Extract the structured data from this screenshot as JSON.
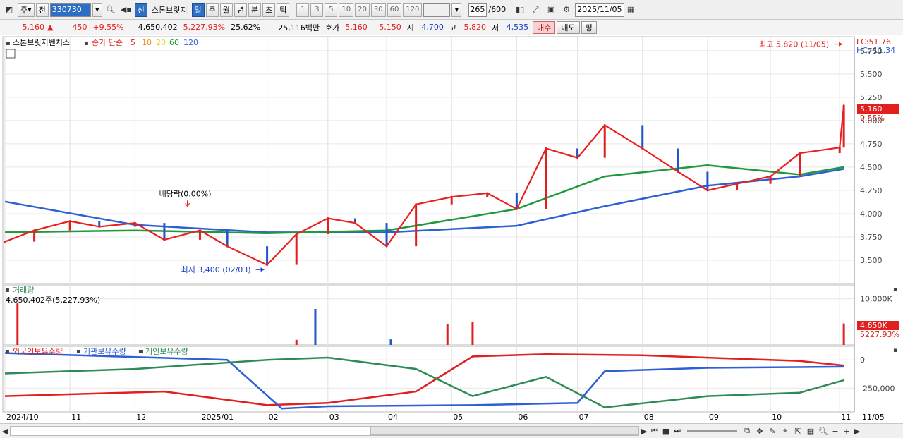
{
  "toolbar": {
    "period_select": "주",
    "prev_label": "전",
    "code": "330730",
    "new_label": "신",
    "name": "스톤브릿지",
    "period_tabs": [
      "일",
      "주",
      "월",
      "년",
      "분",
      "초",
      "틱"
    ],
    "active_tab": "일",
    "intervals": [
      "1",
      "3",
      "5",
      "10",
      "20",
      "30",
      "60",
      "120"
    ],
    "count": "265",
    "count_total": "/600",
    "date": "2025/11/05",
    "icons": [
      "search-icon",
      "sound-icon",
      "candle-icon",
      "compare-icon",
      "save-icon",
      "gear-icon",
      "calendar-icon"
    ]
  },
  "quote": {
    "price": "5,160",
    "arrow": "▲",
    "change": "450",
    "change_pct": "+9.55%",
    "volume": "4,650,402",
    "volume_ratio": "5,227.93%",
    "turnover": "25.62%",
    "amount": "25,116백만",
    "bid_label": "호가",
    "ask": "5,160",
    "bid": "5,150",
    "open_label": "시",
    "open": "4,700",
    "high_label": "고",
    "high": "5,820",
    "low_label": "저",
    "low": "4,535",
    "buy_label": "매수",
    "sell_label": "매도",
    "eval_label": "평"
  },
  "price_panel": {
    "security_name": "스톤브릿지벤처스",
    "legend_title": "종가 단순",
    "lc": "LC:51.76",
    "hc": "HC:-11.34",
    "current_price_tag": "5,160",
    "current_pct_tag": "9.55%",
    "high_annotation": "최고 5,820 (11/05)",
    "low_annotation": "최저 3,400 (02/03)",
    "dividend_annotation": "배당락(0.00%)"
  },
  "volume_panel": {
    "title": "거래량",
    "value_text": "4,650,402주(5,227.93%)",
    "tag_value": "4,650K",
    "tag_pct": "5227.93%"
  },
  "holdings_panel": {
    "titles": [
      "외국인보유수량",
      "기관보유수량",
      "개인보유수량"
    ]
  },
  "x_axis": [
    "2024/10",
    "11",
    "12",
    "2025/01",
    "02",
    "03",
    "04",
    "05",
    "06",
    "07",
    "08",
    "09",
    "10",
    "11",
    "11/05"
  ],
  "colors": {
    "up": "#e0201f",
    "down": "#1d57c8",
    "ma5": "#e8201f",
    "ma10": "#f08c1a",
    "ma20": "#f4e81a",
    "ma60": "#1e9a3c",
    "ma120": "#2e5fd4",
    "foreign": "#e0201f",
    "institution": "#2e5fd4",
    "individual": "#2e8b57"
  },
  "chart_data": {
    "type": "line",
    "title": "스톤브릿지벤처스 종가 단순",
    "price_axis": {
      "ticks": [
        3500,
        3750,
        4000,
        4250,
        4500,
        4750,
        5000,
        5250,
        5500,
        5750
      ],
      "tick_labels": [
        "3,500",
        "3,750",
        "4,000",
        "4,250",
        "4,500",
        "4,750",
        "5,000",
        "5,250",
        "5,500",
        "5,750"
      ],
      "ylim": [
        3250,
        5900
      ]
    },
    "volume_axis": {
      "ticks": [
        10000000
      ],
      "tick_labels": [
        "10,000K"
      ]
    },
    "holdings_axis": {
      "ticks": [
        0,
        -250000
      ],
      "tick_labels": [
        "0",
        "-250,000"
      ]
    },
    "moving_averages": [
      "5",
      "10",
      "20",
      "60",
      "120"
    ],
    "close_series": {
      "x": [
        "2024/10/01",
        "2024/10/15",
        "2024/11/01",
        "2024/11/15",
        "2024/12/02",
        "2024/12/16",
        "2025/01/02",
        "2025/01/15",
        "2025/02/03",
        "2025/02/17",
        "2025/03/04",
        "2025/03/17",
        "2025/04/01",
        "2025/04/15",
        "2025/05/02",
        "2025/05/19",
        "2025/06/02",
        "2025/06/16",
        "2025/07/01",
        "2025/07/14",
        "2025/08/01",
        "2025/08/18",
        "2025/09/01",
        "2025/09/15",
        "2025/10/01",
        "2025/10/15",
        "2025/11/03",
        "2025/11/05"
      ],
      "y": [
        3700,
        3820,
        3920,
        3860,
        3900,
        3720,
        3820,
        3650,
        3450,
        3780,
        3950,
        3900,
        3650,
        4100,
        4180,
        4220,
        4050,
        4700,
        4600,
        4950,
        4700,
        4450,
        4250,
        4320,
        4400,
        4650,
        4710,
        5160
      ]
    },
    "ma60_series": {
      "x": [
        "2024/10/01",
        "2024/12/02",
        "2025/02/03",
        "2025/04/01",
        "2025/06/02",
        "2025/07/14",
        "2025/09/01",
        "2025/10/15",
        "2025/11/05"
      ],
      "y": [
        3800,
        3820,
        3790,
        3820,
        4050,
        4400,
        4520,
        4420,
        4500
      ]
    },
    "ma120_series": {
      "x": [
        "2024/10/01",
        "2024/12/02",
        "2025/02/03",
        "2025/04/01",
        "2025/06/02",
        "2025/07/14",
        "2025/09/01",
        "2025/10/15",
        "2025/11/05"
      ],
      "y": [
        4130,
        3880,
        3800,
        3800,
        3870,
        4080,
        4300,
        4400,
        4480
      ]
    },
    "volume_series": {
      "x": [
        "2024/10/07",
        "2025/02/17",
        "2025/02/26",
        "2025/04/03",
        "2025/04/30",
        "2025/05/12",
        "2025/11/05"
      ],
      "y": [
        9000000,
        1100000,
        7800000,
        1200000,
        4500000,
        5000000,
        4650402
      ]
    },
    "holdings_series": [
      {
        "name": "외국인보유수량",
        "x": [
          "2024/10/01",
          "2024/12/16",
          "2025/02/03",
          "2025/03/04",
          "2025/04/15",
          "2025/05/12",
          "2025/06/16",
          "2025/08/01",
          "2025/10/15",
          "2025/11/05"
        ],
        "y": [
          -320000,
          -280000,
          -400000,
          -380000,
          -280000,
          30000,
          50000,
          40000,
          -10000,
          -50000
        ]
      },
      {
        "name": "기관보유수량",
        "x": [
          "2024/10/01",
          "2025/01/15",
          "2025/02/10",
          "2025/03/04",
          "2025/05/12",
          "2025/07/01",
          "2025/07/14",
          "2025/09/01",
          "2025/11/05"
        ],
        "y": [
          60000,
          0,
          -430000,
          -410000,
          -400000,
          -380000,
          -100000,
          -70000,
          -60000
        ]
      },
      {
        "name": "개인보유수량",
        "x": [
          "2024/10/01",
          "2024/12/02",
          "2025/02/03",
          "2025/03/04",
          "2025/04/15",
          "2025/05/12",
          "2025/06/16",
          "2025/07/14",
          "2025/09/01",
          "2025/10/15",
          "2025/11/05"
        ],
        "y": [
          -120000,
          -80000,
          0,
          20000,
          -80000,
          -320000,
          -150000,
          -420000,
          -320000,
          -290000,
          -180000
        ]
      }
    ]
  }
}
